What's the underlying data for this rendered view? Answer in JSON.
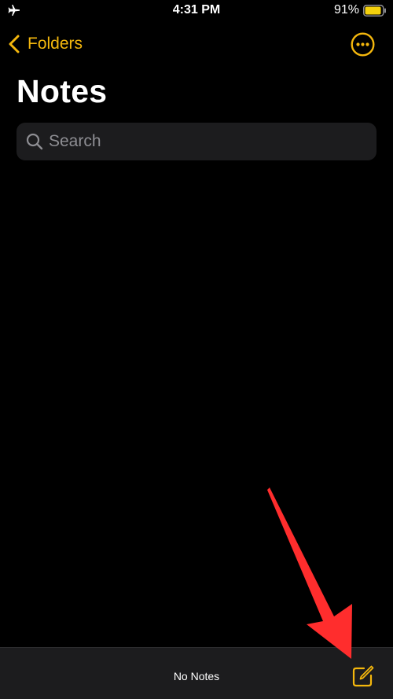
{
  "status_bar": {
    "time": "4:31 PM",
    "battery_percent": "91%",
    "battery_level": 0.91,
    "icons": [
      "airplane-icon",
      "battery-icon"
    ]
  },
  "nav": {
    "back_label": "Folders",
    "more_icon": "ellipsis-circle-icon"
  },
  "header": {
    "title": "Notes"
  },
  "search": {
    "placeholder": "Search"
  },
  "toolbar": {
    "status_text": "No Notes",
    "compose_icon": "compose-icon"
  },
  "colors": {
    "accent": "#f4b70d",
    "background": "#000000",
    "surface": "#1c1c1e",
    "placeholder": "#8e8e93",
    "annotation": "#ff2d2d"
  }
}
